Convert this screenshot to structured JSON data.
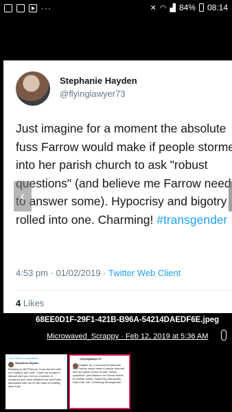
{
  "statusbar": {
    "icons": [
      "image-icon",
      "message-icon",
      "play-icon"
    ],
    "more": "···",
    "battery": "84%",
    "time": "08:14"
  },
  "tweet": {
    "display_name": "Stephanie Hayden",
    "handle": "@flyinglawyer73",
    "text": "Just imagine for a moment the absolute fuss Farrow would make if people stormed into her parish church to ask \"robust questions\" (and believe me Farrow needs to answer some). Hypocrisy and bigotry rolled into one. Charming! ",
    "hashtag": "#transgender",
    "timestamp": "4:53 pm · 01/02/2019 · ",
    "client": "Twitter Web Client",
    "likes_count": "4",
    "likes_label": "Likes"
  },
  "viewer": {
    "filename": "68EE0D1F-29F1-421B-B96A-54214DAEDF6E.jpeg",
    "byline": "Microwaved_Scrappy · Feb 12, 2019 at 5:36 AM"
  },
  "thumbnails": [
    {
      "header": "This Tweet is unavailable",
      "name": "Stephanie Hayden",
      "text": "Replying to @OTFarrow Cross the line with me Caroline and I will. I have not sought to interact with you, but on a number of occasions you have defamed me and those associated with me on the basis of nothing other than"
    },
    {
      "header": "",
      "name": "@flyinglawyer73",
      "text": "Just imagine for a moment the absolute fuss Farrow would make if people stormed into her parish church to ask \"robust questions\" (and believe me Farrow needs to answer some). Hypocrisy and bigotry rolled into one. Charming! #transgender"
    }
  ]
}
